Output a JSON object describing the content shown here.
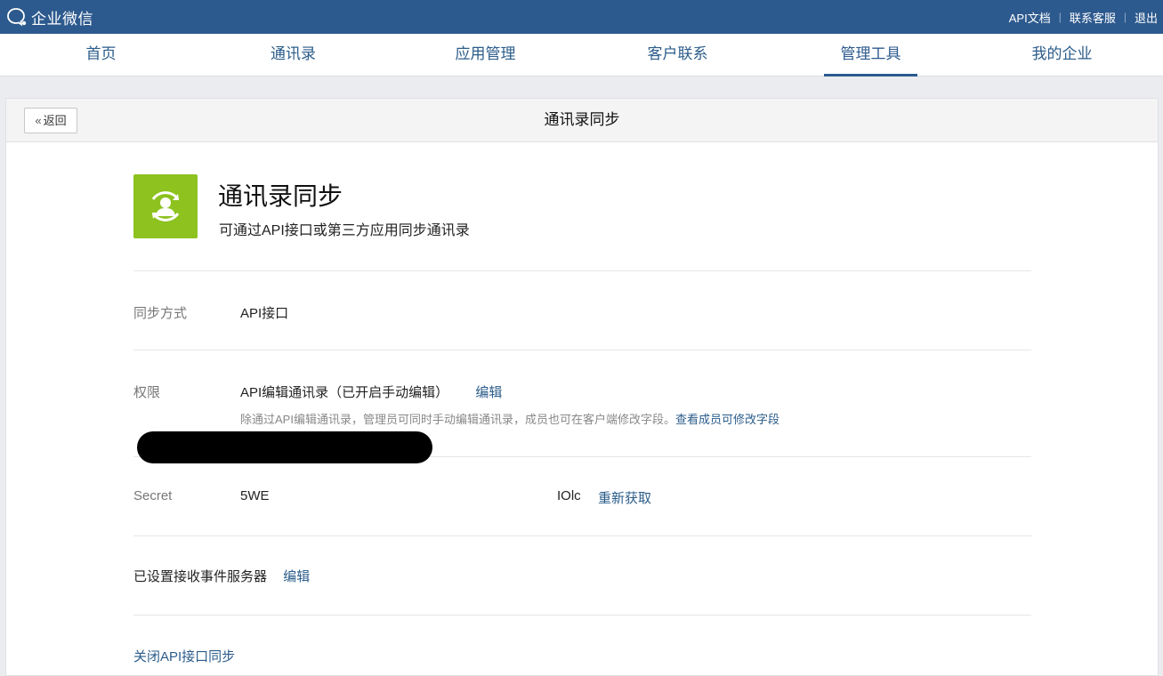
{
  "topbar": {
    "logo_text": "企业微信",
    "links": [
      "API文档",
      "联系客服",
      "退出"
    ],
    "brand_color": "#2d5a8e"
  },
  "nav": {
    "items": [
      "首页",
      "通讯录",
      "应用管理",
      "客户联系",
      "管理工具",
      "我的企业"
    ],
    "active": "管理工具"
  },
  "panel": {
    "back_label": "返回",
    "title": "通讯录同步"
  },
  "app": {
    "name": "通讯录同步",
    "description": "可通过API接口或第三方应用同步通讯录",
    "icon": "contacts-sync-icon",
    "icon_color": "#8dc21f"
  },
  "rows": {
    "sync_method": {
      "label": "同步方式",
      "value": "API接口"
    },
    "permission": {
      "label": "权限",
      "value": "API编辑通讯录（已开启手动编辑）",
      "action": "编辑",
      "hint": "除通过API编辑通讯录，管理员可同时手动编辑通讯录，成员也可在客户端修改字段。",
      "hint_link": "查看成员可修改字段"
    },
    "secret": {
      "label": "Secret",
      "value_prefix": "5WE",
      "value_suffix": "IOlc",
      "action": "重新获取"
    },
    "event_server": {
      "label": "已设置接收事件服务器",
      "action": "编辑"
    },
    "close": {
      "label": "关闭API接口同步"
    }
  }
}
